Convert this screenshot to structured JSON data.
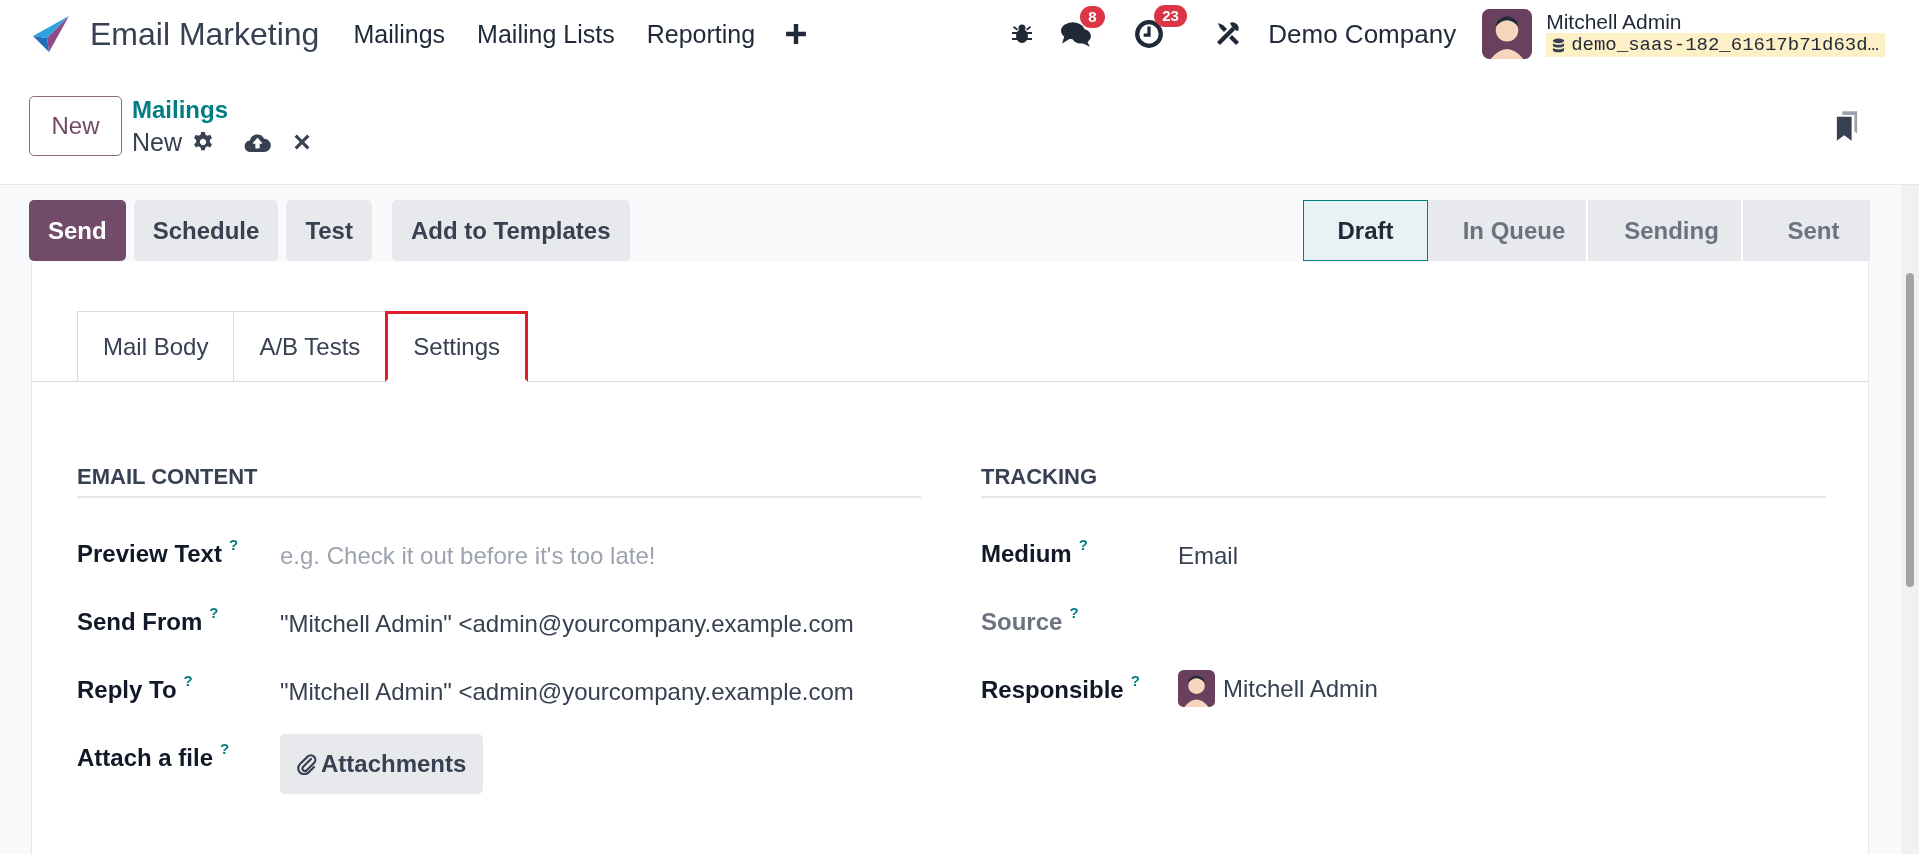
{
  "navbar": {
    "app_name": "Email Marketing",
    "menu": [
      "Mailings",
      "Mailing Lists",
      "Reporting"
    ],
    "messages_count": "8",
    "activities_count": "23",
    "company": "Demo Company",
    "user": "Mitchell Admin",
    "database": "demo_saas-182_61617b71d63d…"
  },
  "control_panel": {
    "new_button": "New",
    "breadcrumb": "Mailings",
    "record_name": "New"
  },
  "action_buttons": [
    {
      "label": "Send",
      "primary": true
    },
    {
      "label": "Schedule",
      "primary": false
    },
    {
      "label": "Test",
      "primary": false
    },
    {
      "label": "Add to Templates",
      "primary": false
    }
  ],
  "statusbar": [
    {
      "label": "Draft",
      "selected": true
    },
    {
      "label": "In Queue",
      "selected": false
    },
    {
      "label": "Sending",
      "selected": false
    },
    {
      "label": "Sent",
      "selected": false
    }
  ],
  "tabs": [
    {
      "label": "Mail Body",
      "selected": false
    },
    {
      "label": "A/B Tests",
      "selected": false
    },
    {
      "label": "Settings",
      "selected": true
    }
  ],
  "groups": [
    {
      "title": "EMAIL CONTENT",
      "fields": [
        {
          "label": "Preview Text",
          "help": "?",
          "kind": "text",
          "readonly": false,
          "placeholder": "e.g. Check it out before it's too late!"
        },
        {
          "label": "Send From",
          "help": "?",
          "kind": "text",
          "readonly": false,
          "value": "\"Mitchell Admin\" <admin@yourcompany.example.com"
        },
        {
          "label": "Reply To",
          "help": "?",
          "kind": "text",
          "readonly": false,
          "value": "\"Mitchell Admin\" <admin@yourcompany.example.com"
        },
        {
          "label": "Attach a file",
          "help": "?",
          "kind": "button",
          "readonly": false,
          "value": "Attachments"
        }
      ]
    },
    {
      "title": "TRACKING",
      "fields": [
        {
          "label": "Medium",
          "help": "?",
          "kind": "text",
          "readonly": false,
          "value": "Email"
        },
        {
          "label": "Source",
          "help": "?",
          "kind": "text",
          "readonly": true
        },
        {
          "label": "Responsible",
          "help": "?",
          "kind": "user",
          "readonly": false,
          "value": "Mitchell Admin"
        }
      ]
    }
  ]
}
